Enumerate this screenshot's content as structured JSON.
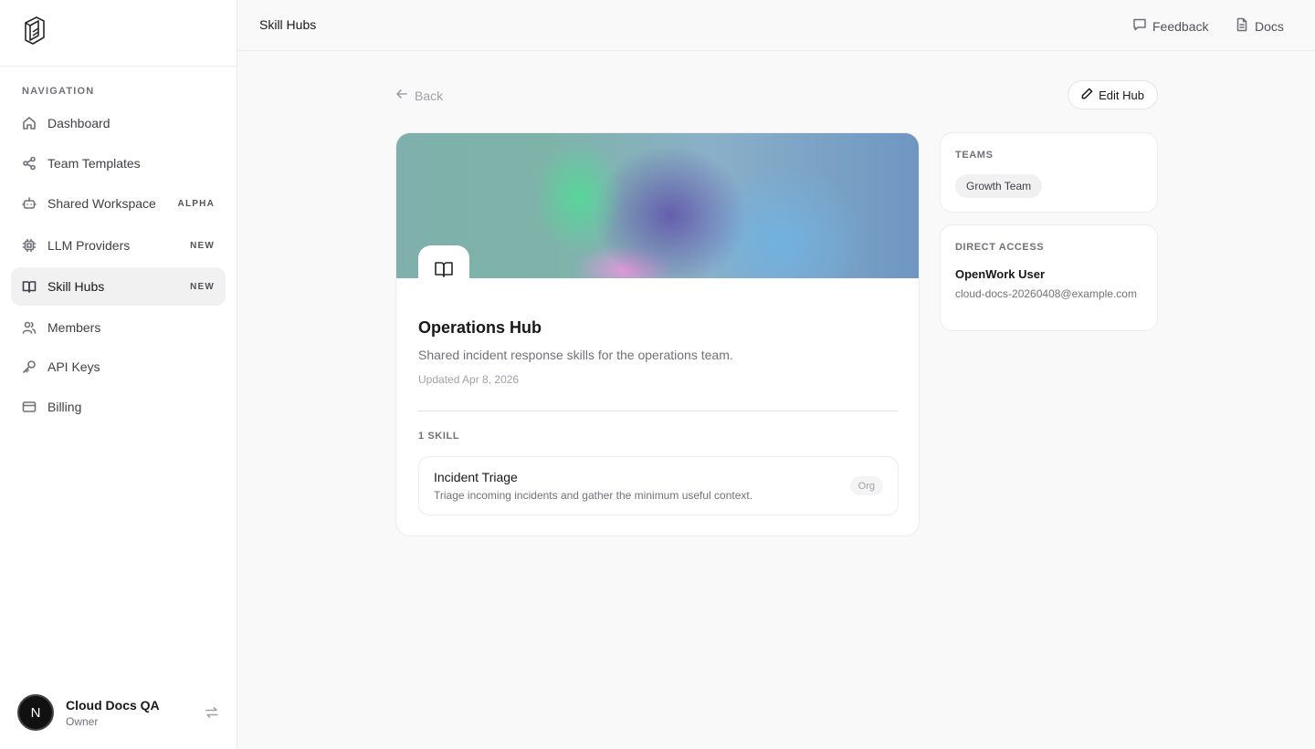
{
  "sidebar": {
    "nav_heading": "NAVIGATION",
    "items": [
      {
        "label": "Dashboard",
        "icon": "home-icon",
        "badge": ""
      },
      {
        "label": "Team Templates",
        "icon": "share-icon",
        "badge": ""
      },
      {
        "label": "Shared Workspace",
        "icon": "robot-icon",
        "badge": "ALPHA"
      },
      {
        "label": "LLM Providers",
        "icon": "cpu-icon",
        "badge": "NEW"
      },
      {
        "label": "Skill Hubs",
        "icon": "book-icon",
        "badge": "NEW",
        "active": true
      },
      {
        "label": "Members",
        "icon": "users-icon",
        "badge": ""
      },
      {
        "label": "API Keys",
        "icon": "key-icon",
        "badge": ""
      },
      {
        "label": "Billing",
        "icon": "credit-card-icon",
        "badge": ""
      }
    ],
    "user": {
      "initial": "N",
      "name": "Cloud Docs QA",
      "role": "Owner"
    }
  },
  "topbar": {
    "title": "Skill Hubs",
    "feedback_label": "Feedback",
    "docs_label": "Docs"
  },
  "main": {
    "back_label": "Back",
    "edit_label": "Edit Hub",
    "hub": {
      "title": "Operations Hub",
      "description": "Shared incident response skills for the operations team.",
      "updated": "Updated Apr 8, 2026",
      "skills_heading": "1 SKILL",
      "skills": [
        {
          "name": "Incident Triage",
          "description": "Triage incoming incidents and gather the minimum useful context.",
          "badge": "Org"
        }
      ]
    },
    "teams": {
      "heading": "TEAMS",
      "chips": [
        "Growth Team"
      ]
    },
    "direct_access": {
      "heading": "DIRECT ACCESS",
      "name": "OpenWork User",
      "email": "cloud-docs-20260408@example.com"
    }
  }
}
